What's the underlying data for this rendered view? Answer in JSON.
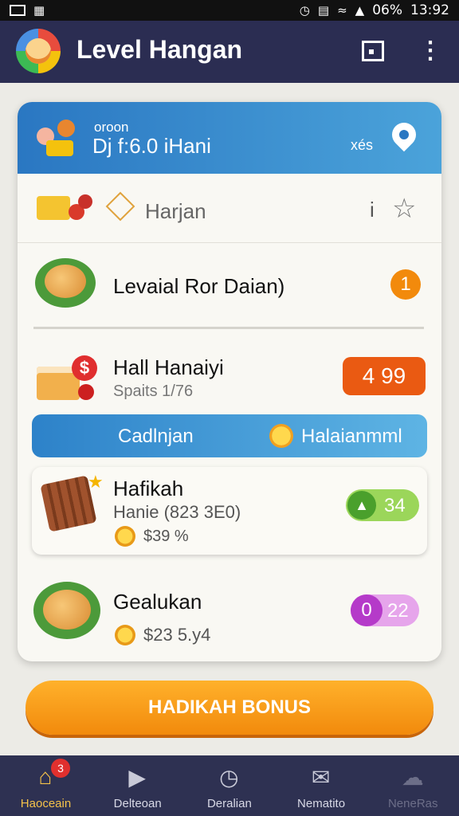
{
  "status_bar": {
    "battery": "06%",
    "time": "13:92"
  },
  "app_bar": {
    "title": "Level Hangan"
  },
  "card_header": {
    "subtitle": "oroon",
    "title": "Dj f:6.0 iHani",
    "extra": "xés"
  },
  "rows": [
    {
      "label": "Harjan"
    },
    {
      "label": "Levaial Ror Daian)",
      "badge": "1"
    },
    {
      "label": "Hall Hanaiyi",
      "sub": "Spaits 1/76",
      "price": "4 99"
    }
  ],
  "category_bar": {
    "label": "Cadlnjan",
    "right_label": "Halaianmml"
  },
  "featured_item": {
    "title": "Hafikah",
    "sub": "Hanie (823 3E0)",
    "price": "$39 %",
    "badge_value": "34"
  },
  "last_item": {
    "title": "Gealukan",
    "price": "$23 5.y4",
    "badge_left": "0",
    "badge_value": "22"
  },
  "bonus_button": {
    "label": "HADIKAH BONUS"
  },
  "bottom_nav": [
    {
      "label": "Haoceain",
      "badge": "3",
      "icon": "home-icon"
    },
    {
      "label": "Delteoan",
      "icon": "play-icon"
    },
    {
      "label": "Deralian",
      "icon": "clock-icon"
    },
    {
      "label": "Nematito",
      "icon": "mail-icon"
    },
    {
      "label": "NeneRas",
      "icon": "cloud-icon"
    }
  ],
  "colors": {
    "appbar": "#2b2d52",
    "accent_orange": "#f28a0c",
    "header_blue": "#2a77c2"
  }
}
